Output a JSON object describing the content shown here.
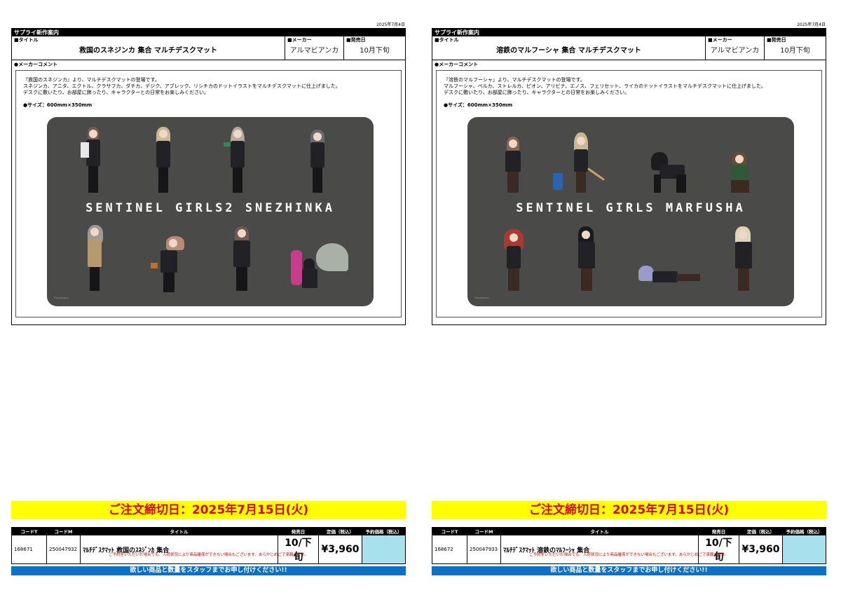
{
  "pages": [
    {
      "date": "2025年7月4日",
      "header": "サプライ新作案内",
      "title_label": "■タイトル",
      "title": "救国のスネジンカ 集合 マルチデスクマット",
      "maker_label": "■メーカー",
      "maker": "アルマビアンカ",
      "release_label": "■発売日",
      "release": "10月下旬",
      "comment_label": "●メーカーコメント",
      "comment": "『救国のスネジンカ』より、マルチデスクマットの登場です。\nスネジンカ、アニタ、エクトル、クラサフカ、ダチカ、デジク、アブレック、リシチカのドットイラストをマルチデスクマットに仕上げました。\nデスクに敷いたり、お部屋に飾ったり、キャラクターとの日常をお楽しみください。",
      "size": "●サイズ：600mm×350mm",
      "mat_title": "SENTINEL GIRLS2 SNEZHINKA",
      "mat_stamp": "©Armabianca",
      "deadline": "ご注文締切日：2025年7月15日(火)",
      "table_headers": [
        "コードT",
        "コードM",
        "タイトル",
        "発売日",
        "定価（税込）",
        "予約価格（税込）"
      ],
      "code_t": "168671",
      "code_m": "250047932",
      "product": "ﾏﾙﾁﾃﾞｽｸﾏｯﾄ 救国のｽﾈｼﾞﾝｶ 集合",
      "release_short": "10/下旬",
      "price": "¥3,960",
      "reserve_price": "",
      "note": "ご予約をいただいた場合でも、入荷状況により商品確保ができない場合もございます。あらかじめご了承願います。",
      "banner": "欲しい商品と数量をスタッフまでお申し付けください!!"
    },
    {
      "date": "2025年7月4日",
      "header": "サプライ新作案内",
      "title_label": "■タイトル",
      "title": "溶鉄のマルフーシャ 集合 マルチデスクマット",
      "maker_label": "■メーカー",
      "maker": "アルマビアンカ",
      "release_label": "■発売日",
      "release": "10月下旬",
      "comment_label": "●メーカーコメント",
      "comment": "『溶鉄のマルフーシャ』より、マルチデスクマットの登場です。\nマルフーシャ、ベルカ、ストレルカ、ピオン、アリビナ、エノス、フェリセット、ライカのドットイラストをマルチデスクマットに仕上げました。\nデスクに敷いたり、お部屋に飾ったり、キャラクターとの日常をお楽しみください。",
      "size": "●サイズ：600mm×350mm",
      "mat_title": "SENTINEL GIRLS MARFUSHA",
      "mat_stamp": "©Armabianca",
      "deadline": "ご注文締切日：2025年7月15日(火)",
      "table_headers": [
        "コードT",
        "コードM",
        "タイトル",
        "発売日",
        "定価（税込）",
        "予約価格（税込）"
      ],
      "code_t": "168672",
      "code_m": "250047933",
      "product": "ﾏﾙﾁﾃﾞｽｸﾏｯﾄ 溶鉄のﾏﾙﾌｰｼｬ 集合",
      "release_short": "10/下旬",
      "price": "¥3,960",
      "reserve_price": "",
      "note": "ご予約をいただいた場合でも、入荷状況により商品確保ができない場合もございます。あらかじめご了承願います。",
      "banner": "欲しい商品と数量をスタッフまでお申し付けください!!"
    }
  ],
  "colors": {
    "deadline_bg": "#ffff00",
    "deadline_text": "#e0002a",
    "banner_bg": "#0a71c4",
    "reserve_cell": "#a9e0ee",
    "mat_bg": "#4a4a49"
  }
}
